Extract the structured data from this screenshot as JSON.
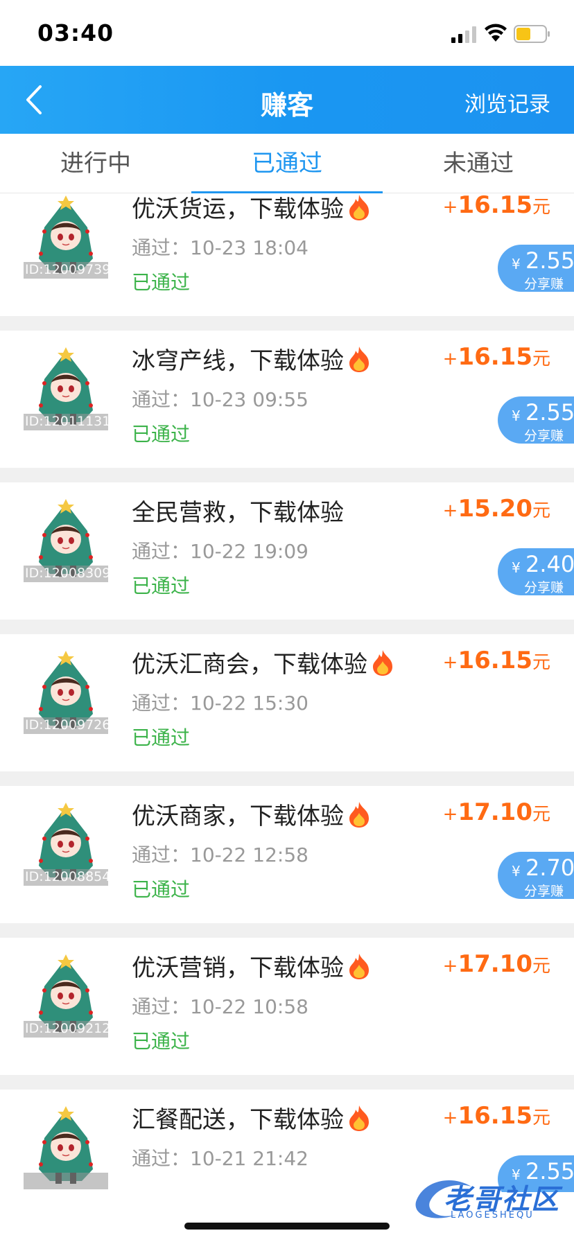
{
  "status_bar": {
    "time": "03:40"
  },
  "nav": {
    "title": "赚客",
    "history_label": "浏览记录"
  },
  "tabs": [
    {
      "label": "进行中",
      "active": false
    },
    {
      "label": "已通过",
      "active": true
    },
    {
      "label": "未通过",
      "active": false
    }
  ],
  "tasks": [
    {
      "avatar_id": "ID:12009739",
      "title": "优沃货运，下载体验",
      "hot": true,
      "time": "通过：10-23 18:04",
      "status": "已通过",
      "reward_plus": "+",
      "reward": "16.15",
      "reward_unit": "元",
      "share_yen": "¥",
      "share_value": "2.55",
      "share_label": "分享赚"
    },
    {
      "avatar_id": "ID:12011131",
      "title": "冰穹产线，下载体验",
      "hot": true,
      "time": "通过：10-23 09:55",
      "status": "已通过",
      "reward_plus": "+",
      "reward": "16.15",
      "reward_unit": "元",
      "share_yen": "¥",
      "share_value": "2.55",
      "share_label": "分享赚"
    },
    {
      "avatar_id": "ID:12008309",
      "title": "全民营救，下载体验",
      "hot": false,
      "time": "通过：10-22 19:09",
      "status": "已通过",
      "reward_plus": "+",
      "reward": "15.20",
      "reward_unit": "元",
      "share_yen": "¥",
      "share_value": "2.40",
      "share_label": "分享赚"
    },
    {
      "avatar_id": "ID:12009726",
      "title": "优沃汇商会，下载体验",
      "hot": true,
      "time": "通过：10-22 15:30",
      "status": "已通过",
      "reward_plus": "+",
      "reward": "16.15",
      "reward_unit": "元"
    },
    {
      "avatar_id": "ID:12008854",
      "title": "优沃商家，下载体验",
      "hot": true,
      "time": "通过：10-22 12:58",
      "status": "已通过",
      "reward_plus": "+",
      "reward": "17.10",
      "reward_unit": "元",
      "share_yen": "¥",
      "share_value": "2.70",
      "share_label": "分享赚"
    },
    {
      "avatar_id": "ID:12009212",
      "title": "优沃营销，下载体验",
      "hot": true,
      "time": "通过：10-22 10:58",
      "status": "已通过",
      "reward_plus": "+",
      "reward": "17.10",
      "reward_unit": "元"
    },
    {
      "avatar_id": "",
      "title": "汇餐配送，下载体验",
      "hot": true,
      "time": "通过：10-21 21:42",
      "status": "",
      "reward_plus": "+",
      "reward": "16.15",
      "reward_unit": "元",
      "share_yen": "¥",
      "share_value": "2.55",
      "share_label": ""
    }
  ],
  "watermark": {
    "text": "老哥社区",
    "sub": "LAOGESHEQU"
  },
  "colors": {
    "nav": "#1c96f1",
    "accent": "#1e96f0",
    "reward": "#ff6a13",
    "status_ok": "#3cb34a",
    "share_pill": "#5aa9f3"
  }
}
